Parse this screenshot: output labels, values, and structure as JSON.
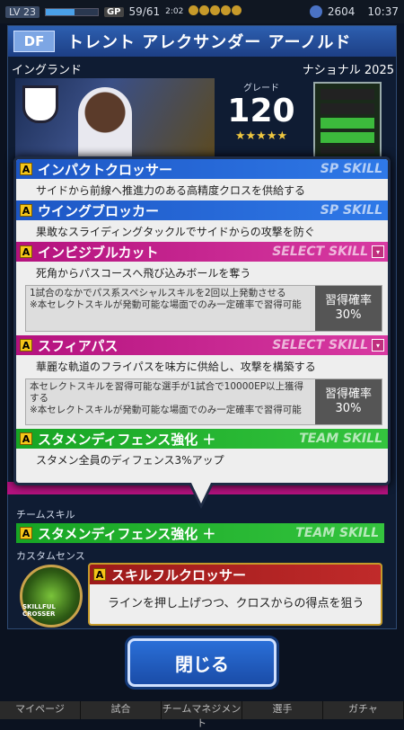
{
  "status": {
    "level": "23",
    "exp_progress": 0.55,
    "exp_text": "",
    "gp_label": "GP",
    "stamina": "59/61",
    "stamina_timer": "2:02",
    "coins": "2604",
    "time": "10:37"
  },
  "player": {
    "position": "DF",
    "name": "トレント アレクサンダー アーノルド",
    "country": "イングランド",
    "category": "ナショナル 2025",
    "grade_label": "グレード",
    "grade": "120",
    "stars": "★★★★★"
  },
  "skills": [
    {
      "name": "インパクトクロッサー",
      "type": "SP SKILL",
      "desc": "サイドから前線へ推進力のある高精度クロスを供給する"
    },
    {
      "name": "ウイングブロッカー",
      "type": "SP SKILL",
      "desc": "果敢なスライディングタックルでサイドからの攻撃を防ぐ"
    },
    {
      "name": "インビジブルカット",
      "type": "SELECT SKILL",
      "desc": "死角からパスコースへ飛び込みボールを奪う",
      "cond": "1試合のなかでパス系スペシャルスキルを2回以上発動させる\n※本セレクトスキルが発動可能な場面でのみ一定確率で習得可能",
      "rate_label": "習得確率",
      "rate": "30%"
    },
    {
      "name": "スフィアパス",
      "type": "SELECT SKILL",
      "desc": "華麗な軌道のフライパスを味方に供給し、攻撃を構築する",
      "cond": "本セレクトスキルを習得可能な選手が1試合で10000EP以上獲得する\n※本セレクトスキルが発動可能な場面でのみ一定確率で習得可能",
      "rate_label": "習得確率",
      "rate": "30%"
    },
    {
      "name": "スタメンディフェンス強化 ＋",
      "type": "TEAM SKILL",
      "desc": "スタメン全員のディフェンス3%アップ"
    }
  ],
  "team_skill": {
    "label": "チームスキル",
    "name": "スタメンディフェンス強化 ＋",
    "type": "TEAM SKILL"
  },
  "custom_sense": {
    "label": "カスタムセンス",
    "icon_text": "SKILLFUL CROSSER",
    "name": "スキルフルクロッサー",
    "desc": "ラインを押し上げつつ、クロスからの得点を狙う"
  },
  "close_label": "閉じる",
  "nav": [
    "マイページ",
    "試合",
    "チームマネジメント",
    "選手",
    "ガチャ"
  ]
}
